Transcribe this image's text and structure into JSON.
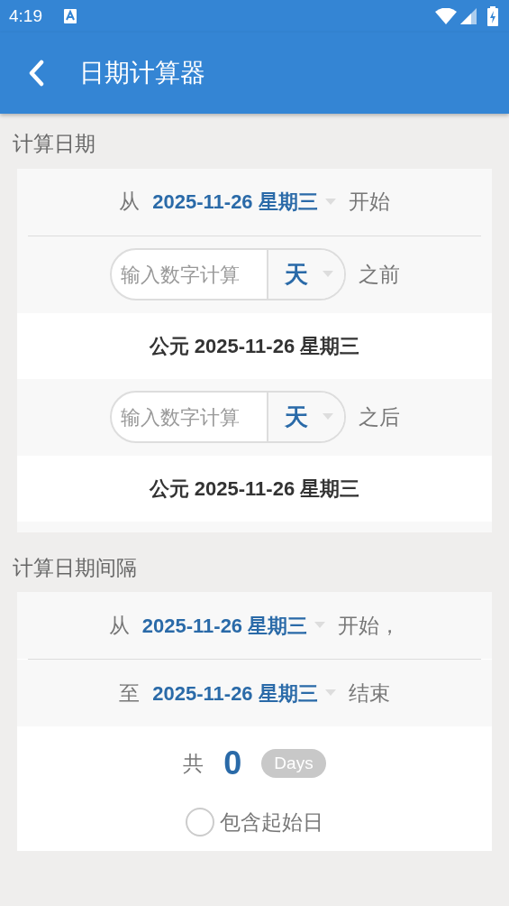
{
  "status_bar": {
    "time": "4:19"
  },
  "app_bar": {
    "title": "日期计算器"
  },
  "calc_date": {
    "title": "计算日期",
    "start": {
      "prefix": "从",
      "date": "2025-11-26 星期三",
      "suffix": "开始"
    },
    "offsets": [
      {
        "placeholder": "输入数字计算",
        "unit": "天",
        "suffix": "之前",
        "result": "公元 2025-11-26 星期三"
      },
      {
        "placeholder": "输入数字计算",
        "unit": "天",
        "suffix": "之后",
        "result": "公元 2025-11-26 星期三"
      }
    ]
  },
  "calc_interval": {
    "title": "计算日期间隔",
    "from": {
      "prefix": "从",
      "date": "2025-11-26 星期三",
      "suffix": "开始，"
    },
    "to": {
      "prefix": "至",
      "date": "2025-11-26 星期三",
      "suffix": "结束"
    },
    "total": {
      "label": "共",
      "value": "0",
      "unit": "Days"
    },
    "include_start": {
      "label": "包含起始日",
      "checked": false
    }
  }
}
